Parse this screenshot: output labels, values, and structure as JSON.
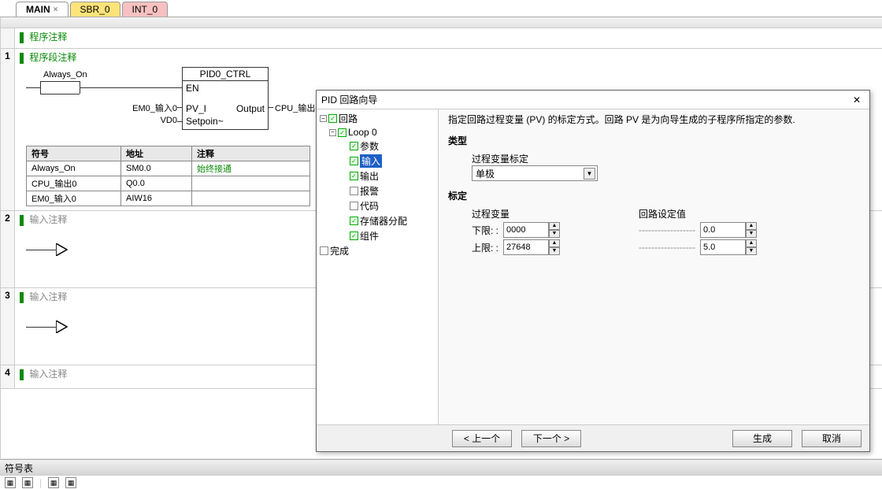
{
  "tabs": {
    "main": "MAIN",
    "sbr0": "SBR_0",
    "int0": "INT_0"
  },
  "program_comment": "程序注释",
  "segment_comment": "程序段注释",
  "ladder": {
    "always_on": "Always_On",
    "block_title": "PID0_CTRL",
    "en": "EN",
    "em0_in": "EM0_输入0",
    "pv_i": "PV_I",
    "output": "Output",
    "cpu_out": "CPU_输出0",
    "vd0": "VD0",
    "setpoint": "Setpoin~"
  },
  "sym_headers": {
    "symbol": "符号",
    "address": "地址",
    "comment": "注释"
  },
  "sym_rows": [
    {
      "s": "Always_On",
      "a": "SM0.0",
      "c": "始终接通"
    },
    {
      "s": "CPU_输出0",
      "a": "Q0.0",
      "c": ""
    },
    {
      "s": "EM0_输入0",
      "a": "AIW16",
      "c": ""
    }
  ],
  "input_comment": "输入注释",
  "dialog": {
    "title": "PID 回路向导",
    "tree": {
      "loop_root": "回路",
      "loop0": "Loop 0",
      "params": "参数",
      "input": "输入",
      "output": "输出",
      "alarm": "报警",
      "code": "代码",
      "memory": "存储器分配",
      "component": "组件",
      "complete": "完成"
    },
    "desc": "指定回路过程变量 (PV) 的标定方式。回路 PV 是为向导生成的子程序所指定的参数.",
    "type_title": "类型",
    "pv_scale_label": "过程变量标定",
    "pv_scale_value": "单极",
    "scale_title": "标定",
    "process_var": "过程变量",
    "loop_setpoint": "回路设定值",
    "lower": "下限: :",
    "upper": "上限: :",
    "val_lower_pv": "0000",
    "val_upper_pv": "27648",
    "val_lower_sp": "0.0",
    "val_upper_sp": "5.0",
    "btn_prev": "< 上一个",
    "btn_next": "下一个 >",
    "btn_gen": "生成",
    "btn_cancel": "取消"
  },
  "bottom_label": "符号表"
}
